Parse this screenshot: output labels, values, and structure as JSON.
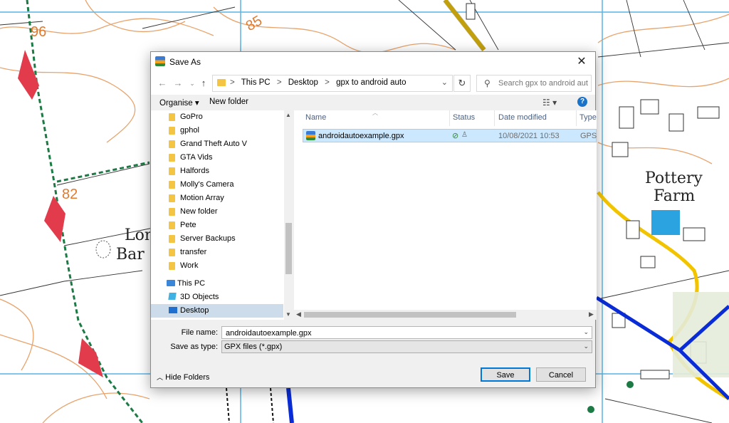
{
  "map": {
    "contour_labels": [
      "96",
      "85",
      "82"
    ],
    "place_labels": [
      "Pottery",
      "Farm",
      "Lon",
      "Bar"
    ]
  },
  "dialog": {
    "title": "Save As",
    "close_glyph": "✕",
    "address": {
      "crumbs": [
        "This PC",
        "Desktop",
        "gpx to android auto"
      ],
      "separator": ">"
    },
    "search": {
      "placeholder": "Search gpx to android auto"
    },
    "toolbar": {
      "organise_label": "Organise ▾",
      "new_folder_label": "New folder"
    },
    "nav_pane": {
      "folders": [
        "GoPro",
        "gphol",
        "Grand Theft Auto V",
        "GTA Vids",
        "Halfords",
        "Molly's Camera",
        "Motion Array",
        "New folder",
        "Pete",
        "Server Backups",
        "transfer",
        "Work"
      ],
      "this_pc_label": "This PC",
      "objects_label": "3D Objects",
      "desktop_label": "Desktop"
    },
    "file_list": {
      "columns": [
        "Name",
        "Status",
        "Date modified",
        "Type"
      ],
      "rows": [
        {
          "name": "androidautoexample.gpx",
          "date_modified": "10/08/2021 10:53",
          "type": "GPS E"
        }
      ]
    },
    "fields": {
      "file_name_label": "File name:",
      "file_name_value": "androidautoexample.gpx",
      "save_as_type_label": "Save as type:",
      "save_as_type_value": "GPX files (*.gpx)"
    },
    "buttons": {
      "hide_folders_label": "Hide Folders",
      "save_label": "Save",
      "cancel_label": "Cancel"
    }
  }
}
